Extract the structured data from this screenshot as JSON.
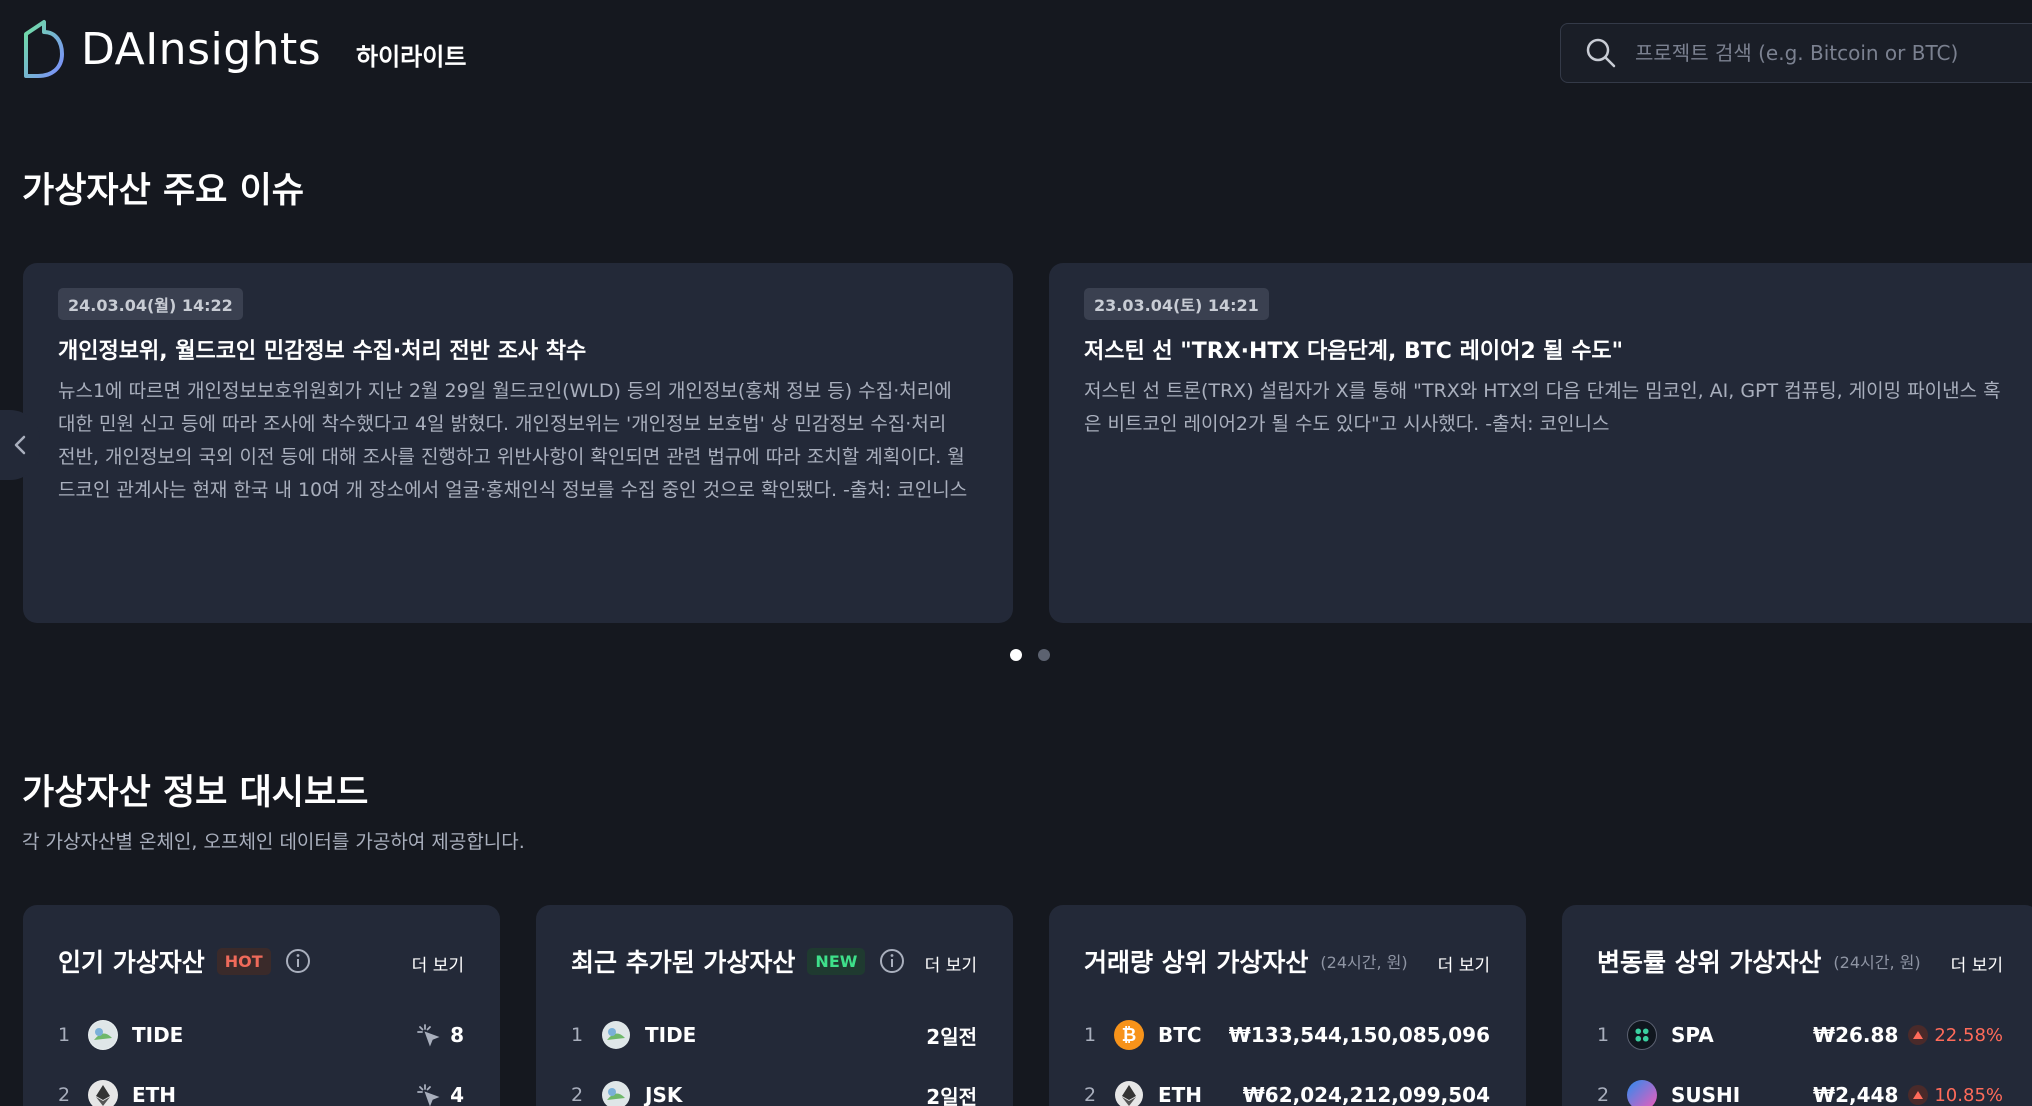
{
  "header": {
    "logo_text": "DAInsights",
    "nav_highlight": "하이라이트",
    "search_placeholder": "프로젝트 검색 (e.g. Bitcoin or BTC)"
  },
  "issues": {
    "title": "가상자산 주요 이슈",
    "cards": [
      {
        "date": "24.03.04(월) 14:22",
        "title": "개인정보위, 월드코인 민감정보 수집·처리 전반 조사 착수",
        "body": "뉴스1에 따르면 개인정보보호위원회가 지난 2월 29일 월드코인(WLD) 등의 개인정보(홍채 정보 등) 수집·처리에 대한 민원 신고 등에 따라 조사에 착수했다고 4일 밝혔다. 개인정보위는 '개인정보 보호법' 상 민감정보 수집·처리 전반, 개인정보의 국외 이전 등에 대해 조사를 진행하고 위반사항이 확인되면 관련 법규에 따라 조치할 계획이다. 월드코인 관계사는 현재 한국 내 10여 개 장소에서 얼굴·홍채인식 정보를 수집 중인 것으로 확인됐다. -출처: 코인니스"
      },
      {
        "date": "23.03.04(토) 14:21",
        "title": "저스틴 선 \"TRX·HTX 다음단계, BTC 레이어2 될 수도\"",
        "body": "저스틴 선 트론(TRX) 설립자가 X를 통해 \"TRX와 HTX의 다음 단계는 밈코인, AI, GPT 컴퓨팅, 게이밍 파이낸스 혹은 비트코인 레이어2가 될 수도 있다\"고 시사했다. -출처: 코인니스"
      }
    ]
  },
  "dashboard": {
    "title": "가상자산 정보 대시보드",
    "subtitle": "각 가상자산별 온체인, 오프체인 데이터를 가공하여 제공합니다.",
    "more_label": "더 보기",
    "panels": [
      {
        "title": "인기 가상자산",
        "badge": "HOT",
        "rows": [
          {
            "rank": "1",
            "symbol": "TIDE",
            "value": "8"
          },
          {
            "rank": "2",
            "symbol": "ETH",
            "value": "4"
          }
        ]
      },
      {
        "title": "최근 추가된 가상자산",
        "badge": "NEW",
        "rows": [
          {
            "rank": "1",
            "symbol": "TIDE",
            "value": "2일전"
          },
          {
            "rank": "2",
            "symbol": "JSK",
            "value": "2일전"
          }
        ]
      },
      {
        "title": "거래량 상위 가상자산",
        "sub": "(24시간, 원)",
        "rows": [
          {
            "rank": "1",
            "symbol": "BTC",
            "value": "₩133,544,150,085,096"
          },
          {
            "rank": "2",
            "symbol": "ETH",
            "value": "₩62,024,212,099,504"
          }
        ]
      },
      {
        "title": "변동률 상위 가상자산",
        "sub": "(24시간, 원)",
        "rows": [
          {
            "rank": "1",
            "symbol": "SPA",
            "value": "₩26.88",
            "change": "22.58%"
          },
          {
            "rank": "2",
            "symbol": "SUSHI",
            "value": "₩2,448",
            "change": "10.85%"
          }
        ]
      }
    ]
  },
  "colors": {
    "background": "#15181f",
    "card": "#232938",
    "hot": "#ef6a5a",
    "new": "#3ee08a",
    "up": "#ff6b5a",
    "btc": "#f7931a"
  }
}
